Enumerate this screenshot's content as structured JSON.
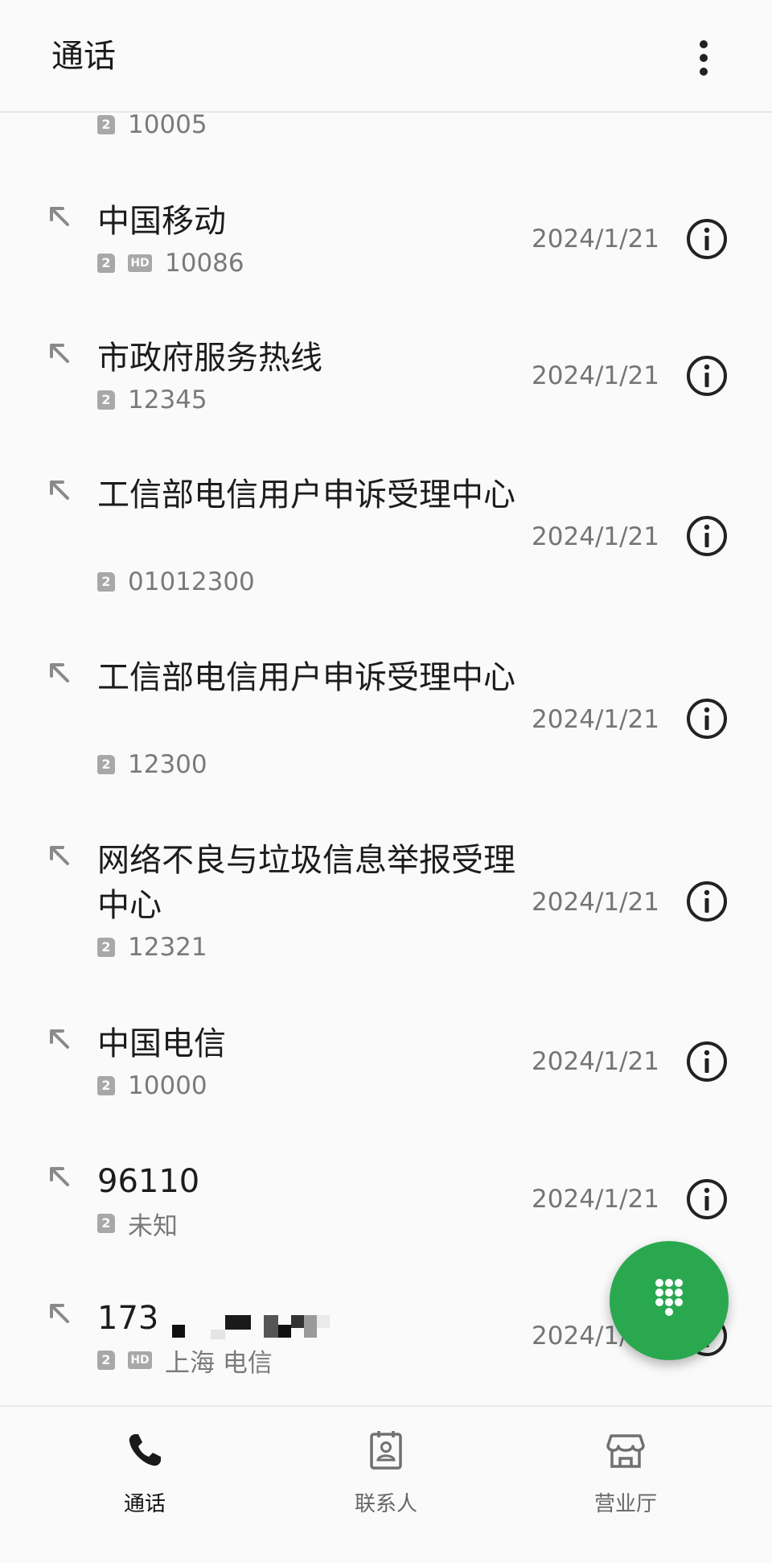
{
  "header": {
    "title": "通话",
    "more_icon": "more-vert-icon"
  },
  "calls": [
    {
      "name": "",
      "sim": "2",
      "hd": false,
      "number": "10005",
      "date": "",
      "partial": true
    },
    {
      "name": "中国移动",
      "sim": "2",
      "hd": true,
      "hd_label": "HD",
      "number": "10086",
      "date": "2024/1/21"
    },
    {
      "name": "市政府服务热线",
      "sim": "2",
      "hd": false,
      "number": "12345",
      "date": "2024/1/21"
    },
    {
      "name": "工信部电信用户申诉受理中心",
      "sim": "2",
      "hd": false,
      "number": "01012300",
      "date": "2024/1/21"
    },
    {
      "name": "工信部电信用户申诉受理中心",
      "sim": "2",
      "hd": false,
      "number": "12300",
      "date": "2024/1/21"
    },
    {
      "name": "网络不良与垃圾信息举报受理中心",
      "sim": "2",
      "hd": false,
      "number": "12321",
      "date": "2024/1/21"
    },
    {
      "name": "中国电信",
      "sim": "2",
      "hd": false,
      "number": "10000",
      "date": "2024/1/21"
    },
    {
      "name": "96110",
      "sim": "2",
      "hd": false,
      "number": "未知",
      "date": "2024/1/21"
    },
    {
      "name": "173",
      "sim": "2",
      "hd": true,
      "hd_label": "HD",
      "number": "上海 电信",
      "date": "2024/1/21"
    }
  ],
  "fab": {
    "icon": "dialpad-icon"
  },
  "bottom_nav": {
    "items": [
      {
        "label": "通话",
        "icon": "phone-icon",
        "active": true
      },
      {
        "label": "联系人",
        "icon": "contacts-icon",
        "active": false
      },
      {
        "label": "营业厅",
        "icon": "store-icon",
        "active": false
      }
    ]
  },
  "colors": {
    "accent": "#2aa84f",
    "background": "#fafafa",
    "secondary_text": "#757575"
  }
}
